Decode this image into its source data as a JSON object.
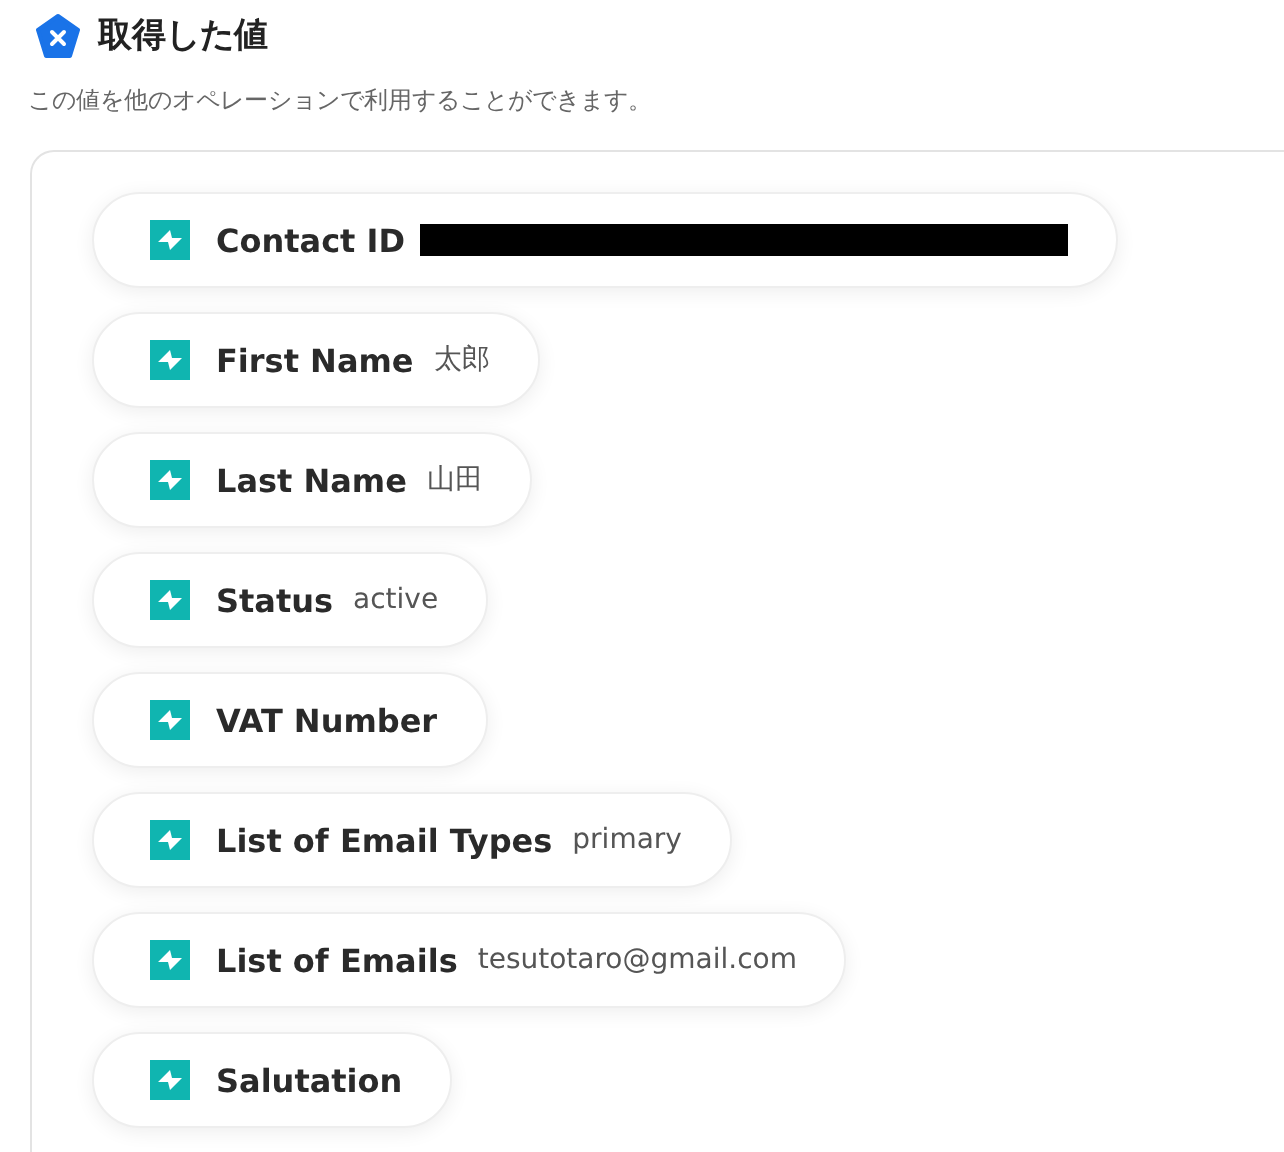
{
  "header": {
    "title": "取得した値",
    "description": "この値を他のオペレーションで利用することができます。"
  },
  "fields": [
    {
      "label": "Contact ID",
      "redacted": true
    },
    {
      "label": "First Name",
      "value": "太郎",
      "redacted": false
    },
    {
      "label": "Last Name",
      "value": "山田",
      "redacted": false
    },
    {
      "label": "Status",
      "value": "active",
      "redacted": false
    },
    {
      "label": "VAT Number",
      "redacted": false
    },
    {
      "label": "List of Email Types",
      "value": "primary",
      "redacted": false
    },
    {
      "label": "List of Emails",
      "value": "tesutotaro@gmail.com",
      "redacted": false
    },
    {
      "label": "Salutation",
      "redacted": false
    }
  ]
}
